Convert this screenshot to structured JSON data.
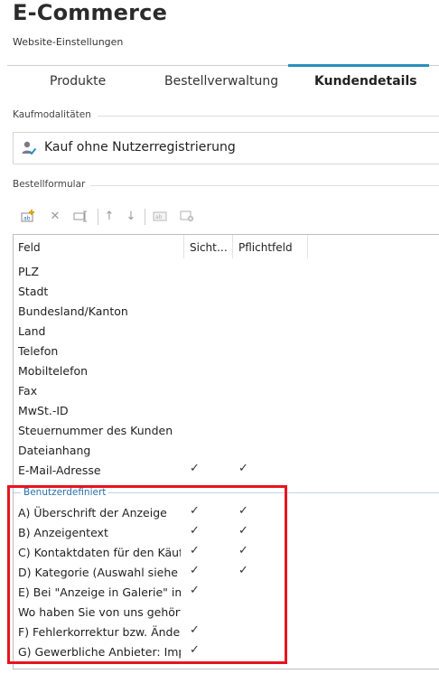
{
  "app": {
    "title": "E-Commerce",
    "subtitle": "Website-Einstellungen"
  },
  "tabs": [
    {
      "label": "Produkte"
    },
    {
      "label": "Bestellverwaltung"
    },
    {
      "label": "Kundendetails"
    }
  ],
  "purchase_mode": {
    "section_label": "Kaufmodalitäten",
    "value": "Kauf ohne Nutzerregistrierung"
  },
  "order_form": {
    "section_label": "Bestellformular",
    "columns": {
      "field": "Feld",
      "visible": "Sicht…",
      "required": "Pflichtfeld"
    },
    "standard_rows": [
      {
        "label": "PLZ",
        "visible": "",
        "required": ""
      },
      {
        "label": "Stadt",
        "visible": "",
        "required": ""
      },
      {
        "label": "Bundesland/Kanton",
        "visible": "",
        "required": ""
      },
      {
        "label": "Land",
        "visible": "",
        "required": ""
      },
      {
        "label": "Telefon",
        "visible": "",
        "required": ""
      },
      {
        "label": "Mobiltelefon",
        "visible": "",
        "required": ""
      },
      {
        "label": "Fax",
        "visible": "",
        "required": ""
      },
      {
        "label": "MwSt.-ID",
        "visible": "",
        "required": ""
      },
      {
        "label": "Steuernummer des Kunden",
        "visible": "",
        "required": ""
      },
      {
        "label": "Dateianhang",
        "visible": "",
        "required": ""
      },
      {
        "label": "E-Mail-Adresse",
        "visible": "✓",
        "required": "✓"
      }
    ],
    "custom_group_label": "Benutzerdefiniert",
    "custom_rows": [
      {
        "label": "A) Überschrift der Anzeige",
        "visible": "✓",
        "required": "✓"
      },
      {
        "label": "B) Anzeigentext",
        "visible": "✓",
        "required": "✓"
      },
      {
        "label": "C) Kontaktdaten für den Käufer",
        "visible": "✓",
        "required": "✓"
      },
      {
        "label": "D) Kategorie (Auswahl siehe ...",
        "visible": "✓",
        "required": "✓"
      },
      {
        "label": "E) Bei \"Anzeige in Galerie\" im...",
        "visible": "✓",
        "required": ""
      },
      {
        "label": "Wo haben Sie von uns gehört?",
        "visible": "",
        "required": ""
      },
      {
        "label": "F) Fehlerkorrektur bzw. Änder...",
        "visible": "✓",
        "required": ""
      },
      {
        "label": "G) Gewerbliche Anbieter: Imp...",
        "visible": "✓",
        "required": ""
      }
    ]
  },
  "colors": {
    "accent": "#2a8fbd",
    "highlight": "#e8141e",
    "group_text": "#2b6fa8"
  },
  "icons": [
    "user-check-icon",
    "add-field-icon",
    "delete-icon",
    "rename-icon",
    "arrow-up-icon",
    "arrow-down-icon",
    "field-type-icon",
    "settings-icon"
  ]
}
